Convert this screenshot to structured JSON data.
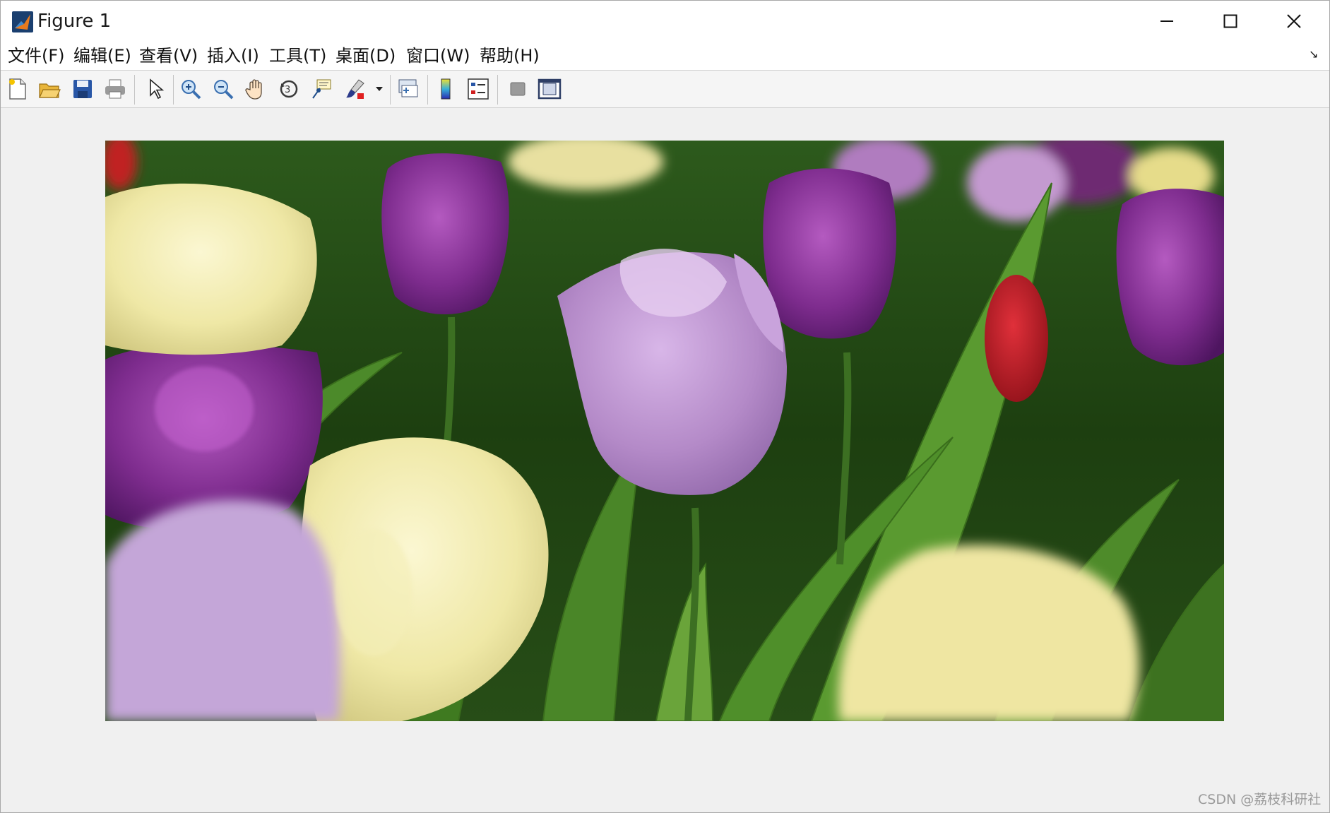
{
  "window": {
    "title": "Figure 1"
  },
  "menu": [
    {
      "label": "文件(F)"
    },
    {
      "label": "编辑(E)"
    },
    {
      "label": "查看(V)"
    },
    {
      "label": "插入(I)"
    },
    {
      "label": "工具(T)"
    },
    {
      "label": "桌面(D)"
    },
    {
      "label": "窗口(W)"
    },
    {
      "label": "帮助(H)"
    }
  ],
  "toolbar_icons": [
    "new-figure-icon",
    "open-file-icon",
    "save-icon",
    "print-icon",
    "select-arrow-icon",
    "zoom-in-icon",
    "zoom-out-icon",
    "pan-hand-icon",
    "rotate-3d-icon",
    "data-cursor-icon",
    "brush-icon",
    "brush-dropdown-icon",
    "link-plot-icon",
    "colorbar-icon",
    "legend-icon",
    "hide-plot-tools-icon",
    "show-plot-tools-icon"
  ],
  "image": {
    "subject": "tulips"
  },
  "watermark": "CSDN @荔枝科研社",
  "colors": {
    "titlebar": "#ffffff",
    "background": "#f0f0f0",
    "toolbar": "#f5f5f5"
  }
}
